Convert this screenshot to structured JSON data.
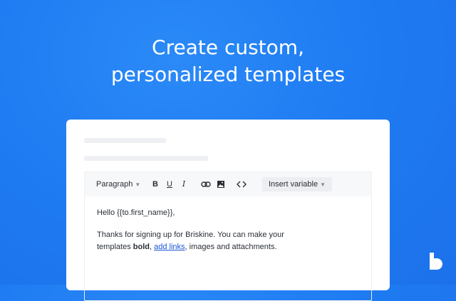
{
  "headline": {
    "line1": "Create custom,",
    "line2": "personalized templates"
  },
  "toolbar": {
    "format_select": "Paragraph",
    "bold_label": "B",
    "underline_label": "U",
    "italic_label": "I",
    "insert_variable_label": "Insert variable"
  },
  "editor": {
    "greeting": "Hello {{to.first_name}},",
    "body_line1": "Thanks for signing up for Briskine. You can make your",
    "body_prefix": "templates ",
    "body_bold": "bold",
    "body_comma": ", ",
    "body_link": "add links",
    "body_suffix": ", images and attachments."
  },
  "icons": [
    "chevron-down-icon",
    "link-icon",
    "image-icon",
    "code-icon",
    "briskine-logo-icon"
  ],
  "colors": {
    "background": "#1f7cf2",
    "link": "#1a54d8",
    "card": "#ffffff",
    "toolbar": "#f7f8fa"
  }
}
